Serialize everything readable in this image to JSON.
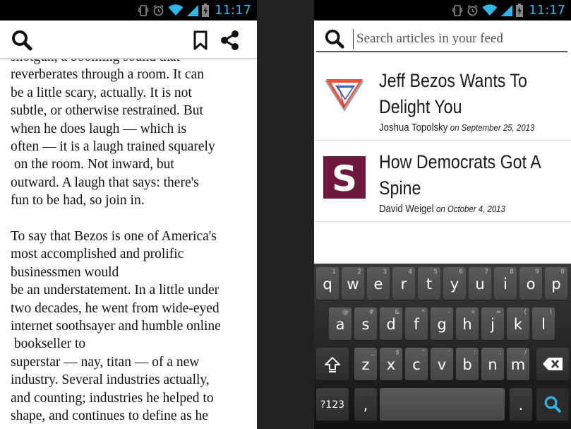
{
  "status_bar": {
    "time": "11:17"
  },
  "reader": {
    "paragraphs": [
      [
        "shotgun, a booming sound that",
        "reverberates through a room. It can",
        "be a little scary, actually. It is not",
        "subtle, or otherwise restrained. But",
        "when he does laugh — which is",
        "often — it is a laugh trained squarely",
        " on the room. Not inward, but",
        "outward. A laugh that says: there's",
        "fun to be had, so join in."
      ],
      [
        "To say that Bezos is one of America's",
        "most accomplished and prolific",
        "businessmen would",
        "be an understatement. In a little under",
        "two decades, he went from wide-eyed",
        "internet soothsayer and humble online",
        " bookseller to",
        "superstar — nay, titan — of a new",
        "industry. Several industries actually,",
        "and counting; industries he helped to",
        "shape, and continues to define as he"
      ]
    ]
  },
  "search": {
    "placeholder": "Search articles in your feed",
    "results": [
      {
        "title_line1": "Jeff Bezos Wants To",
        "title_line2": "Delight You",
        "author": "Joshua Topolsky",
        "date": "on September 25, 2013",
        "logo": "verge-logo",
        "accent": "#e2453c"
      },
      {
        "title_line1": "How Democrats Got A",
        "title_line2": "Spine",
        "author": "David Weigel",
        "date": "on October 4, 2013",
        "logo": "slate-logo",
        "accent": "#6e1a3a"
      }
    ]
  },
  "keyboard": {
    "row1": [
      {
        "k": "q",
        "h": "1"
      },
      {
        "k": "w",
        "h": "2"
      },
      {
        "k": "e",
        "h": "3"
      },
      {
        "k": "r",
        "h": "4"
      },
      {
        "k": "t",
        "h": "5"
      },
      {
        "k": "y",
        "h": "6"
      },
      {
        "k": "u",
        "h": "7"
      },
      {
        "k": "i",
        "h": "8"
      },
      {
        "k": "o",
        "h": "9"
      },
      {
        "k": "p",
        "h": "0"
      }
    ],
    "row2": [
      {
        "k": "a",
        "h": "@"
      },
      {
        "k": "s",
        "h": "#"
      },
      {
        "k": "d",
        "h": "&"
      },
      {
        "k": "f",
        "h": "*"
      },
      {
        "k": "g",
        "h": "-"
      },
      {
        "k": "h",
        "h": "+"
      },
      {
        "k": "j",
        "h": "="
      },
      {
        "k": "k",
        "h": "("
      },
      {
        "k": "l",
        "h": ")"
      }
    ],
    "row3": [
      {
        "k": "z",
        "h": "_"
      },
      {
        "k": "x",
        "h": "$"
      },
      {
        "k": "c",
        "h": "\""
      },
      {
        "k": "v",
        "h": "'"
      },
      {
        "k": "b",
        "h": ":"
      },
      {
        "k": "n",
        "h": ";"
      },
      {
        "k": "m",
        "h": "/"
      }
    ],
    "symbols_label": "?123",
    "comma": ",",
    "period": "."
  }
}
